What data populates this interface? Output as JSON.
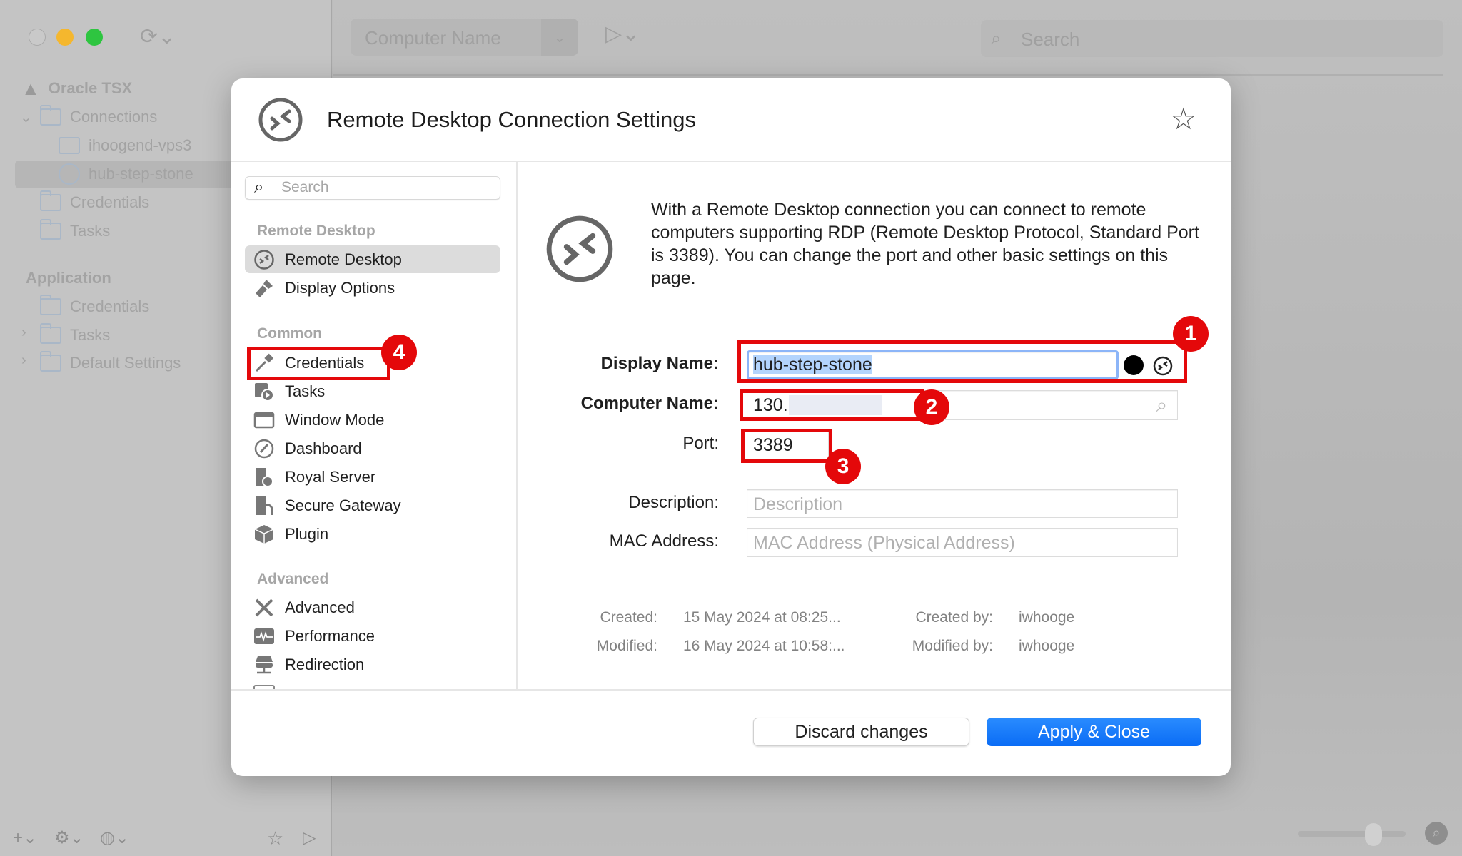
{
  "window": {
    "sidebar": {
      "items": [
        {
          "label": "Oracle TSX",
          "icon": "warning-icon"
        },
        {
          "label": "Connections",
          "icon": "folder-icon"
        },
        {
          "label": "ihoogend-vps3",
          "icon": "terminal-icon"
        },
        {
          "label": "hub-step-stone",
          "icon": "remote-desktop-icon",
          "selected": true
        },
        {
          "label": "Credentials",
          "icon": "folder-icon"
        },
        {
          "label": "Tasks",
          "icon": "folder-icon"
        }
      ],
      "application_heading": "Application",
      "application_items": [
        {
          "label": "Credentials"
        },
        {
          "label": "Tasks"
        },
        {
          "label": "Default Settings"
        }
      ]
    },
    "toolbar": {
      "computer_name_placeholder": "Computer Name",
      "search_placeholder": "Search"
    }
  },
  "dialog": {
    "title": "Remote Desktop Connection Settings",
    "nav": {
      "search_placeholder": "Search",
      "sections": [
        {
          "heading": "Remote Desktop",
          "items": [
            "Remote Desktop",
            "Display Options"
          ]
        },
        {
          "heading": "Common",
          "items": [
            "Credentials",
            "Tasks",
            "Window Mode",
            "Dashboard",
            "Royal Server",
            "Secure Gateway",
            "Plugin"
          ]
        },
        {
          "heading": "Advanced",
          "items": [
            "Advanced",
            "Performance",
            "Redirection"
          ]
        }
      ],
      "selected": "Remote Desktop"
    },
    "intro": "With a Remote Desktop connection you can connect to remote computers supporting RDP (Remote Desktop Protocol, Standard Port is 3389). You can change the port and other basic settings on this page.",
    "form": {
      "display_name_label": "Display Name:",
      "display_name_value": "hub-step-stone",
      "computer_name_label": "Computer Name:",
      "computer_name_value": "130.",
      "port_label": "Port:",
      "port_value": "3389",
      "description_label": "Description:",
      "description_placeholder": "Description",
      "mac_label": "MAC Address:",
      "mac_placeholder": "MAC Address (Physical Address)"
    },
    "meta": {
      "created_label": "Created:",
      "created_value": "15 May 2024 at 08:25...",
      "modified_label": "Modified:",
      "modified_value": "16 May 2024 at 10:58:...",
      "created_by_label": "Created by:",
      "created_by_value": "iwhooge",
      "modified_by_label": "Modified by:",
      "modified_by_value": "iwhooge"
    },
    "buttons": {
      "discard": "Discard changes",
      "apply": "Apply & Close"
    },
    "annotations": [
      "1",
      "2",
      "3",
      "4"
    ],
    "colors": {
      "accent": "#0a6cf5",
      "annotation": "#e4080a"
    }
  }
}
